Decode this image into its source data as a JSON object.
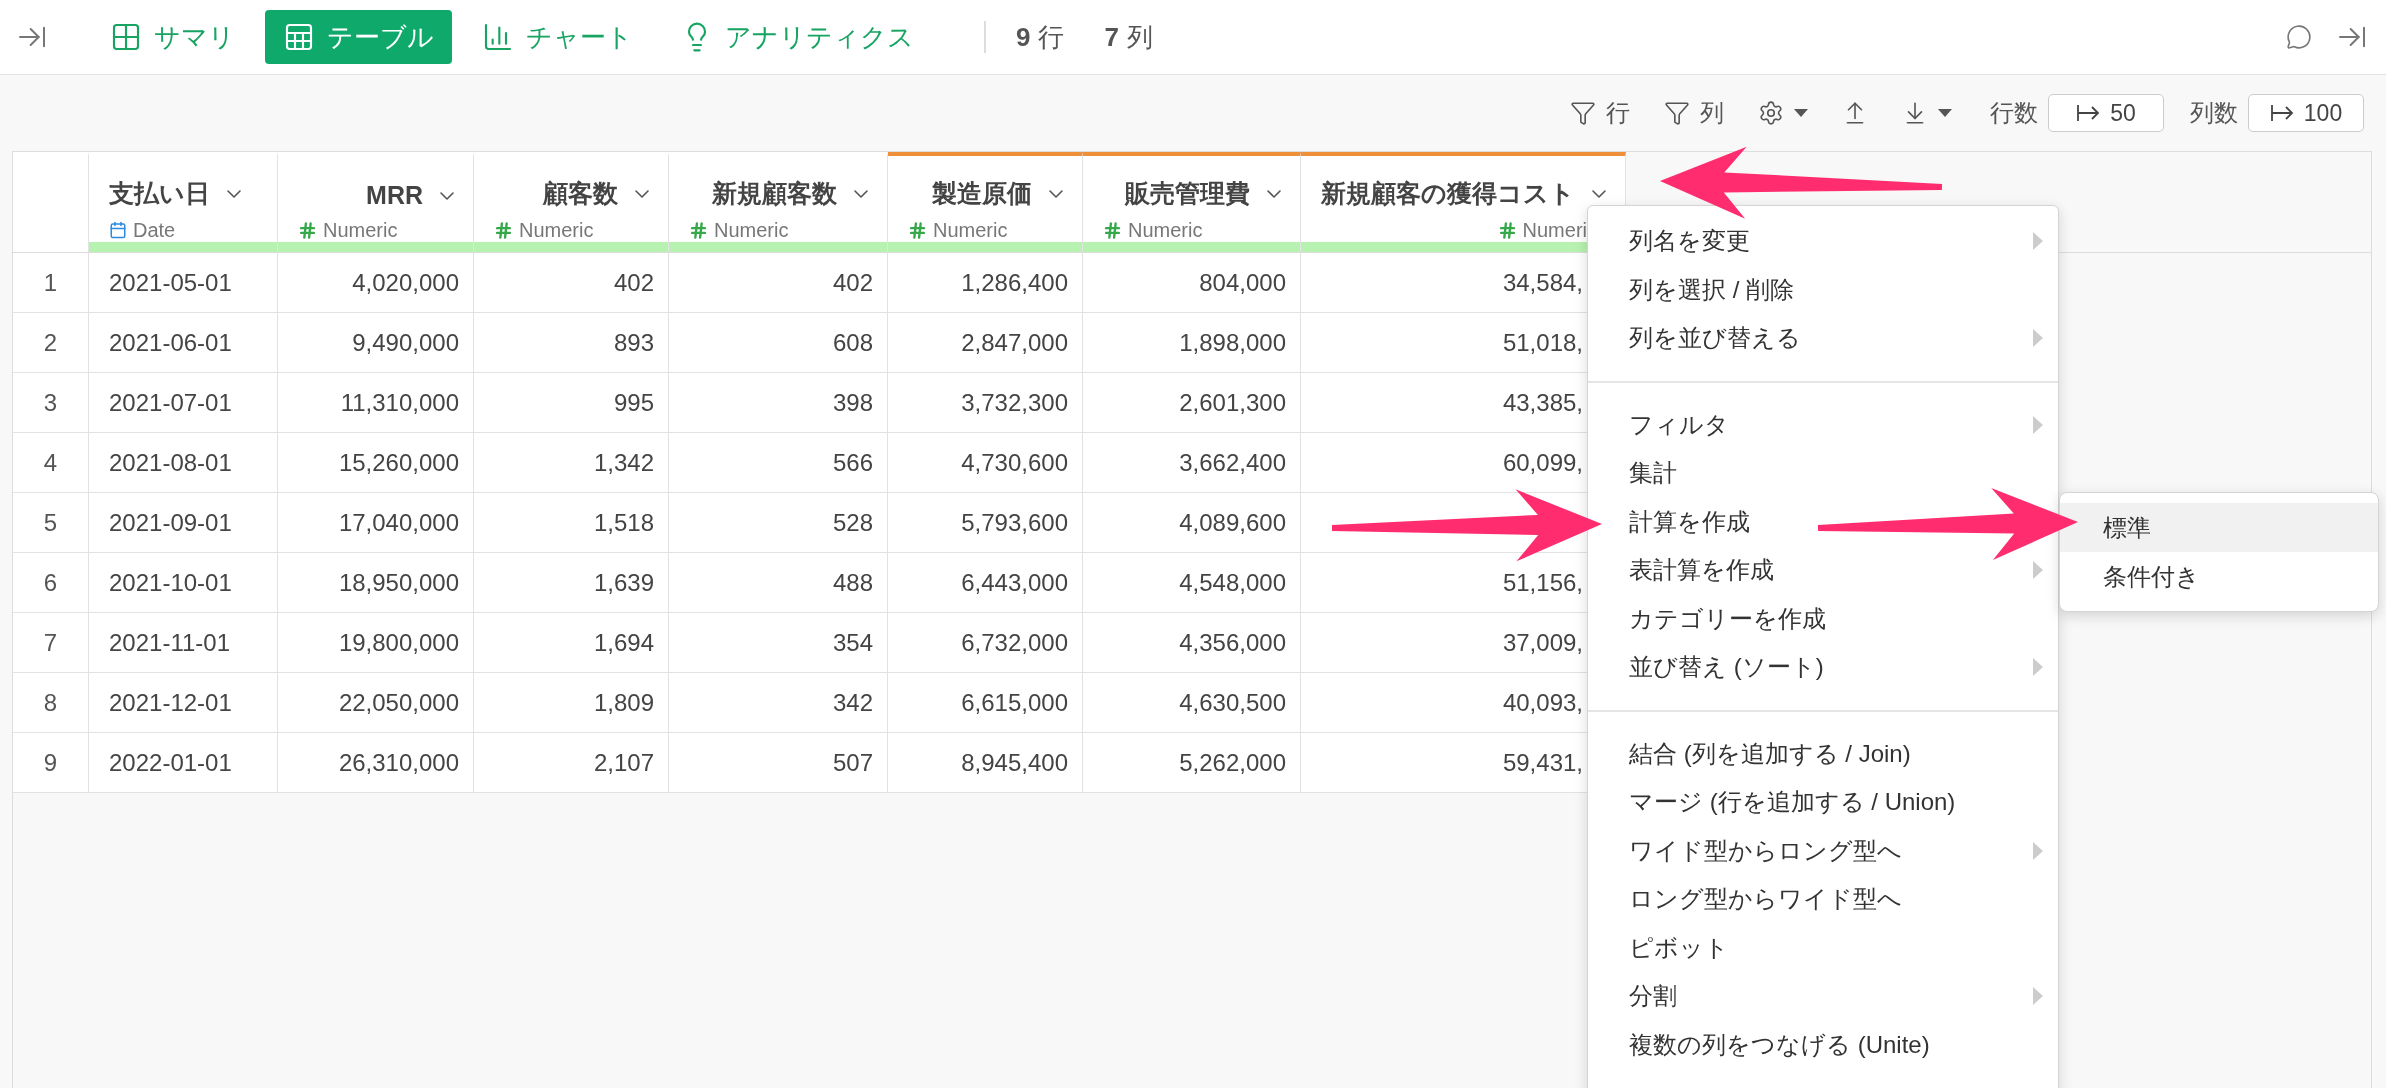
{
  "tabs": [
    {
      "label": "サマリ",
      "kind": "summary",
      "selected": false
    },
    {
      "label": "テーブル",
      "kind": "table",
      "selected": true
    },
    {
      "label": "チャート",
      "kind": "chart",
      "selected": false
    },
    {
      "label": "アナリティクス",
      "kind": "analytics",
      "selected": false
    }
  ],
  "counts": [
    {
      "value": "9",
      "unit": "行"
    },
    {
      "value": "7",
      "unit": "列"
    }
  ],
  "toolbar": {
    "row_filter": "行",
    "column_filter": "列",
    "row_limit_label": "行数",
    "row_limit": "50",
    "column_limit_label": "列数",
    "column_limit": "100"
  },
  "table": {
    "columns": [
      {
        "name": "支払い日",
        "type": "Date",
        "kind": "date",
        "highlighted": false
      },
      {
        "name": "MRR",
        "type": "Numeric",
        "kind": "numeric",
        "highlighted": false
      },
      {
        "name": "顧客数",
        "type": "Numeric",
        "kind": "numeric",
        "highlighted": false
      },
      {
        "name": "新規顧客数",
        "type": "Numeric",
        "kind": "numeric",
        "highlighted": false
      },
      {
        "name": "製造原価",
        "type": "Numeric",
        "kind": "numeric",
        "highlighted": true
      },
      {
        "name": "販売管理費",
        "type": "Numeric",
        "kind": "numeric",
        "highlighted": true
      },
      {
        "name": "新規顧客の獲得コスト",
        "type": "Numeri",
        "kind": "numeric",
        "highlighted": true
      }
    ],
    "rows": [
      {
        "number": "1",
        "cells": [
          "2021-05-01",
          "4,020,000",
          "402",
          "402",
          "1,286,400",
          "804,000",
          "34,584,"
        ]
      },
      {
        "number": "2",
        "cells": [
          "2021-06-01",
          "9,490,000",
          "893",
          "608",
          "2,847,000",
          "1,898,000",
          "51,018,"
        ]
      },
      {
        "number": "3",
        "cells": [
          "2021-07-01",
          "11,310,000",
          "995",
          "398",
          "3,732,300",
          "2,601,300",
          "43,385,"
        ]
      },
      {
        "number": "4",
        "cells": [
          "2021-08-01",
          "15,260,000",
          "1,342",
          "566",
          "4,730,600",
          "3,662,400",
          "60,099,"
        ]
      },
      {
        "number": "5",
        "cells": [
          "2021-09-01",
          "17,040,000",
          "1,518",
          "528",
          "5,793,600",
          "4,089,600"
        ]
      },
      {
        "number": "6",
        "cells": [
          "2021-10-01",
          "18,950,000",
          "1,639",
          "488",
          "6,443,000",
          "4,548,000",
          "51,156,"
        ]
      },
      {
        "number": "7",
        "cells": [
          "2021-11-01",
          "19,800,000",
          "1,694",
          "354",
          "6,732,000",
          "4,356,000",
          "37,009,"
        ]
      },
      {
        "number": "8",
        "cells": [
          "2021-12-01",
          "22,050,000",
          "1,809",
          "342",
          "6,615,000",
          "4,630,500",
          "40,093,"
        ]
      },
      {
        "number": "9",
        "cells": [
          "2022-01-01",
          "26,310,000",
          "2,107",
          "507",
          "8,945,400",
          "5,262,000",
          "59,431,"
        ]
      }
    ]
  },
  "column_menu": {
    "groups": [
      [
        {
          "label": "列名を変更",
          "has_submenu": true
        },
        {
          "label": "列を選択 / 削除",
          "has_submenu": false
        },
        {
          "label": "列を並び替える",
          "has_submenu": true
        }
      ],
      [
        {
          "label": "フィルタ",
          "has_submenu": true
        },
        {
          "label": "集計",
          "has_submenu": false
        },
        {
          "label": "計算を作成"
        },
        {
          "label": "表計算を作成",
          "has_submenu": true
        },
        {
          "label": "カテゴリーを作成",
          "has_submenu": false
        },
        {
          "label": "並び替え (ソート)",
          "has_submenu": true
        }
      ],
      [
        {
          "label": "結合 (列を追加する / Join)",
          "has_submenu": false
        },
        {
          "label": "マージ (行を追加する / Union)",
          "has_submenu": false
        },
        {
          "label": "ワイド型からロング型へ",
          "has_submenu": true
        },
        {
          "label": "ロング型からワイド型へ",
          "has_submenu": false
        },
        {
          "label": "ピボット",
          "has_submenu": false
        },
        {
          "label": "分割",
          "has_submenu": true
        },
        {
          "label": "複数の列をつなげる (Unite)",
          "has_submenu": false
        }
      ]
    ],
    "submenu": [
      {
        "label": "標準",
        "selected": true
      },
      {
        "label": "条件付き",
        "selected": false
      }
    ]
  }
}
